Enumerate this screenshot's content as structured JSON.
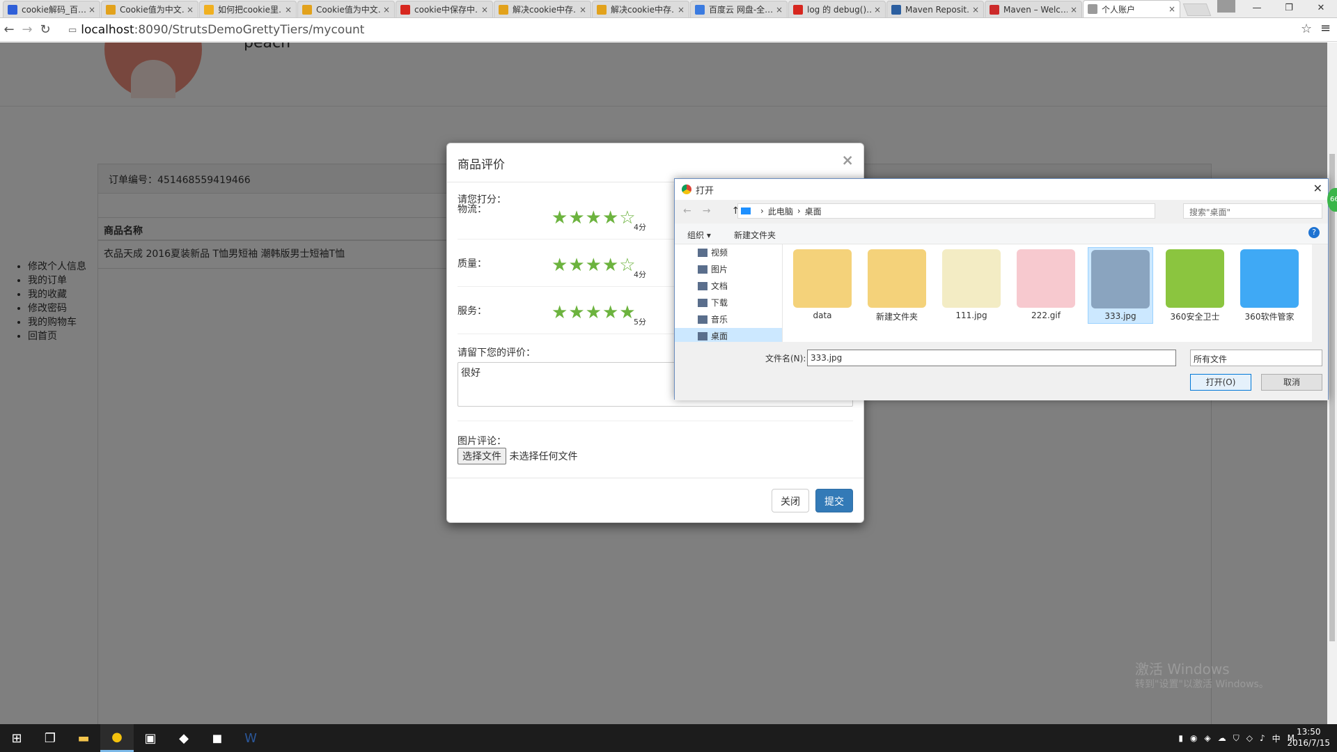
{
  "browser": {
    "tabs": [
      {
        "title": "cookie解码_百…",
        "color": "#2f5fd8"
      },
      {
        "title": "Cookie值为中文…",
        "color": "#e2a21c"
      },
      {
        "title": "如何把cookie里…",
        "color": "#f0b020"
      },
      {
        "title": "Cookie值为中文…",
        "color": "#e2a21c"
      },
      {
        "title": "cookie中保存中…",
        "color": "#d7271f"
      },
      {
        "title": "解决cookie中存…",
        "color": "#e2a21c"
      },
      {
        "title": "解决cookie中存…",
        "color": "#e2a21c"
      },
      {
        "title": "百度云 网盘-全…",
        "color": "#3b7be0"
      },
      {
        "title": "log 的 debug()…",
        "color": "#d7271f"
      },
      {
        "title": "Maven Reposit…",
        "color": "#2c5fa0"
      },
      {
        "title": "Maven – Welc…",
        "color": "#cc2a2a"
      },
      {
        "title": "个人账户",
        "color": "#9a9a9a"
      }
    ],
    "url_host": "localhost",
    "url_rest": ":8090/StrutsDemoGrettyTiers/mycount"
  },
  "profile": {
    "username": "peach"
  },
  "sidebar": [
    "修改个人信息",
    "我的订单",
    "我的收藏",
    "修改密码",
    "我的购物车",
    "回首页"
  ],
  "order": {
    "number_label": "订单编号：451468559419466",
    "col_header": "商品名称",
    "product": "衣品天成 2016夏装新品 T恤男短袖 潮韩版男士短袖T恤"
  },
  "modal": {
    "title": "商品评价",
    "prompt": "请您打分：",
    "ratings": [
      {
        "label": "物流：",
        "score": 4,
        "score_text": "4分"
      },
      {
        "label": "质量：",
        "score": 4,
        "score_text": "4分"
      },
      {
        "label": "服务：",
        "score": 5,
        "score_text": "5分"
      }
    ],
    "comment_label": "请留下您的评价：",
    "comment_value": "很好",
    "image_label": "图片评论：",
    "file_button": "选择文件",
    "file_status": "未选择任何文件",
    "close_button": "关闭",
    "submit_button": "提交"
  },
  "file_dialog": {
    "title": "打开",
    "path": [
      "此电脑",
      "桌面"
    ],
    "search_placeholder": "搜索\"桌面\"",
    "organize": "组织 ▾",
    "new_folder": "新建文件夹",
    "tree": [
      "视频",
      "图片",
      "文档",
      "下载",
      "音乐",
      "桌面"
    ],
    "files": [
      {
        "name": "data",
        "color": "#f4d27a"
      },
      {
        "name": "新建文件夹",
        "color": "#f4d27a"
      },
      {
        "name": "111.jpg",
        "color": "#f3ecc4"
      },
      {
        "name": "222.gif",
        "color": "#f7c9cf"
      },
      {
        "name": "333.jpg",
        "color": "#8aa4bf"
      },
      {
        "name": "360安全卫士",
        "color": "#8bc53f"
      },
      {
        "name": "360软件管家",
        "color": "#3fa9f5"
      }
    ],
    "filename_label": "文件名(N):",
    "filename_value": "333.jpg",
    "filetype": "所有文件",
    "open_button": "打开(O)",
    "cancel_button": "取消"
  },
  "watermark": {
    "line1": "激活 Windows",
    "line2": "转到\"设置\"以激活 Windows。"
  },
  "clock": {
    "time": "13:50",
    "date": "2016/7/15"
  },
  "tray_lang": "中"
}
